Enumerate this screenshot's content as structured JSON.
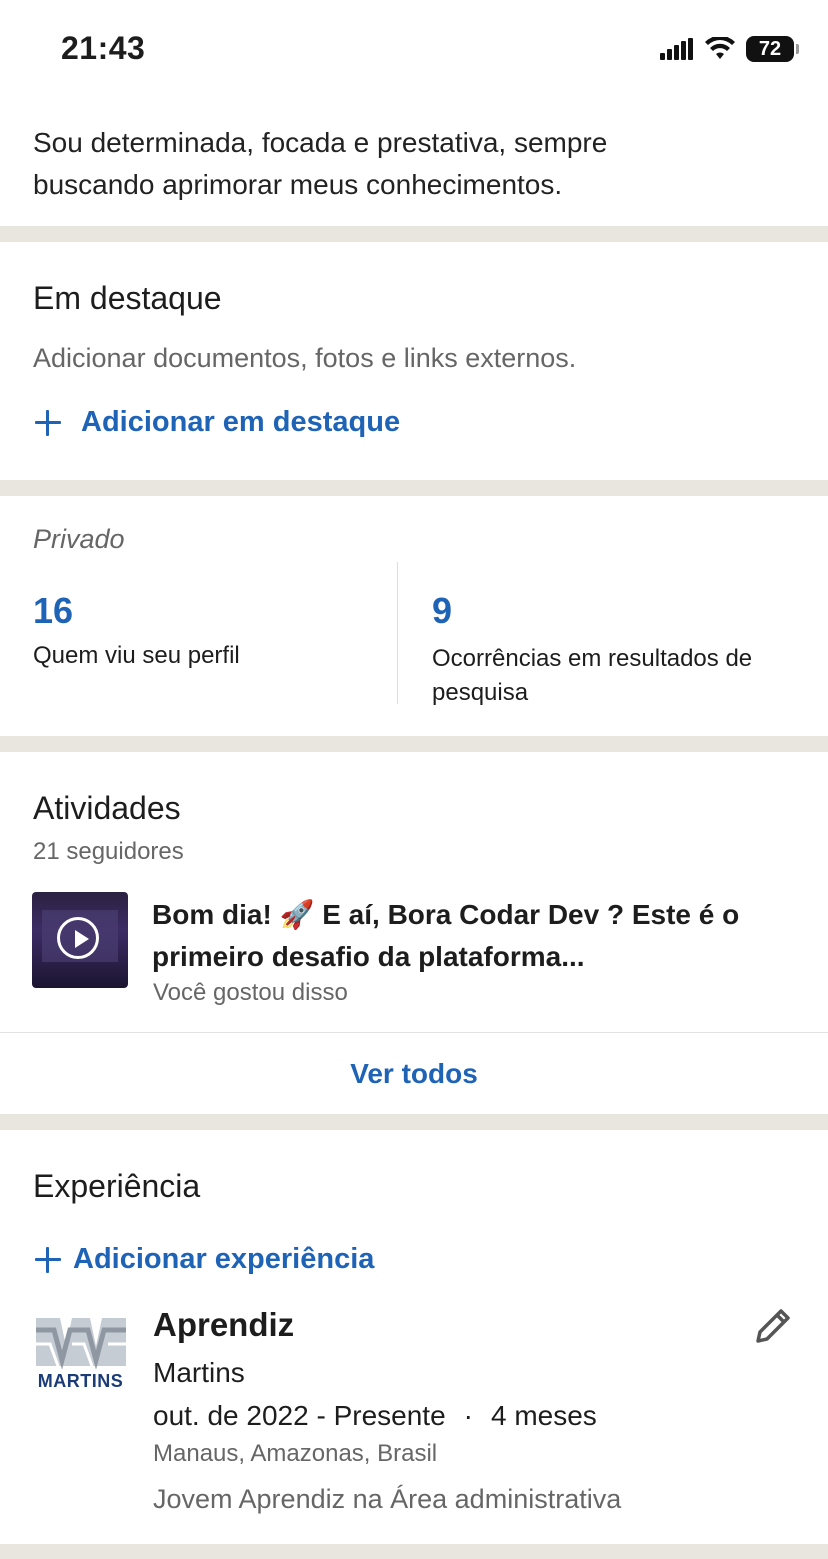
{
  "status_bar": {
    "time": "21:43",
    "battery": "72"
  },
  "about": {
    "text": "Sou determinada, focada e prestativa, sempre buscando aprimorar meus conhecimentos."
  },
  "featured": {
    "title": "Em destaque",
    "description": "Adicionar documentos, fotos e links externos.",
    "add_label": "Adicionar em destaque"
  },
  "analytics": {
    "label": "Privado",
    "profile_views": {
      "count": "16",
      "label": "Quem viu seu perfil"
    },
    "search_appearances": {
      "count": "9",
      "label": "Ocorrências em resultados de pesquisa"
    }
  },
  "activity": {
    "title": "Atividades",
    "followers": "21 seguidores",
    "post": {
      "text": "Bom dia! 🚀 E aí, Bora Codar Dev ? Este é o primeiro desafio da plataforma...",
      "reaction": "Você gostou disso"
    },
    "see_all": "Ver todos"
  },
  "experience": {
    "title": "Experiência",
    "add_label": "Adicionar experiência",
    "items": [
      {
        "logo_text": "MARTINS",
        "role": "Aprendiz",
        "company": "Martins",
        "period": "out. de 2022 - Presente",
        "separator": "·",
        "duration": "4 meses",
        "location": "Manaus, Amazonas, Brasil",
        "description": "Jovem Aprendiz na Área administrativa"
      }
    ]
  },
  "colors": {
    "accent": "#0a66c2",
    "link": "#1f63b6",
    "divider": "#e9e5df"
  },
  "icons": [
    "signal-icon",
    "wifi-icon",
    "battery-icon",
    "plus-icon",
    "play-icon",
    "pencil-icon"
  ]
}
